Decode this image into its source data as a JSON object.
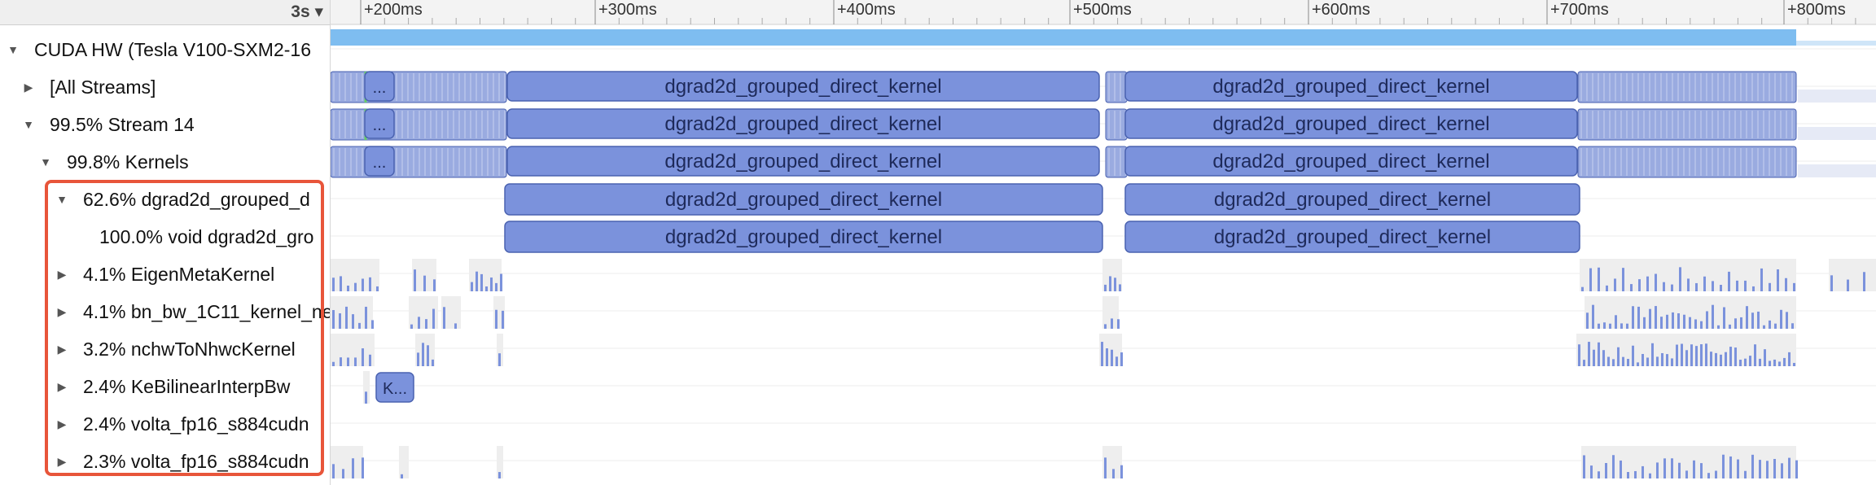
{
  "toolbar": {
    "zoom_label": "3s ▾"
  },
  "ruler": {
    "ticks": [
      "+200ms",
      "+300ms",
      "+400ms",
      "+500ms",
      "+600ms",
      "+700ms",
      "+800ms"
    ]
  },
  "tree": [
    {
      "label": "CUDA HW (Tesla V100-SXM2-16",
      "toggle": "▼"
    },
    {
      "label": "[All Streams]",
      "toggle": "▶"
    },
    {
      "label": "99.5% Stream 14",
      "toggle": "▼"
    },
    {
      "label": "99.8% Kernels",
      "toggle": "▼"
    },
    {
      "label": "62.6% dgrad2d_grouped_d",
      "toggle": "▼"
    },
    {
      "label": "100.0% void dgrad2d_gro",
      "toggle": ""
    },
    {
      "label": "4.1% EigenMetaKernel",
      "toggle": "▶"
    },
    {
      "label": "4.1% bn_bw_1C11_kernel_ne",
      "toggle": "▶"
    },
    {
      "label": "3.2% nchwToNhwcKernel",
      "toggle": "▶"
    },
    {
      "label": "2.4% KeBilinearInterpBw",
      "toggle": "▶"
    },
    {
      "label": "2.4% volta_fp16_s884cudn",
      "toggle": "▶"
    },
    {
      "label": "2.3% volta_fp16_s884cudn",
      "toggle": "▶"
    }
  ],
  "kernels": {
    "main_name": "dgrad2d_grouped_direct_kernel",
    "ellipsis": "...",
    "short_k": "K..."
  },
  "colors": {
    "kernel_fill": "#7b92dc",
    "kernel_stroke": "#4a62b0",
    "hw_bar": "#7ebdf0",
    "selection": "#e8553a"
  }
}
